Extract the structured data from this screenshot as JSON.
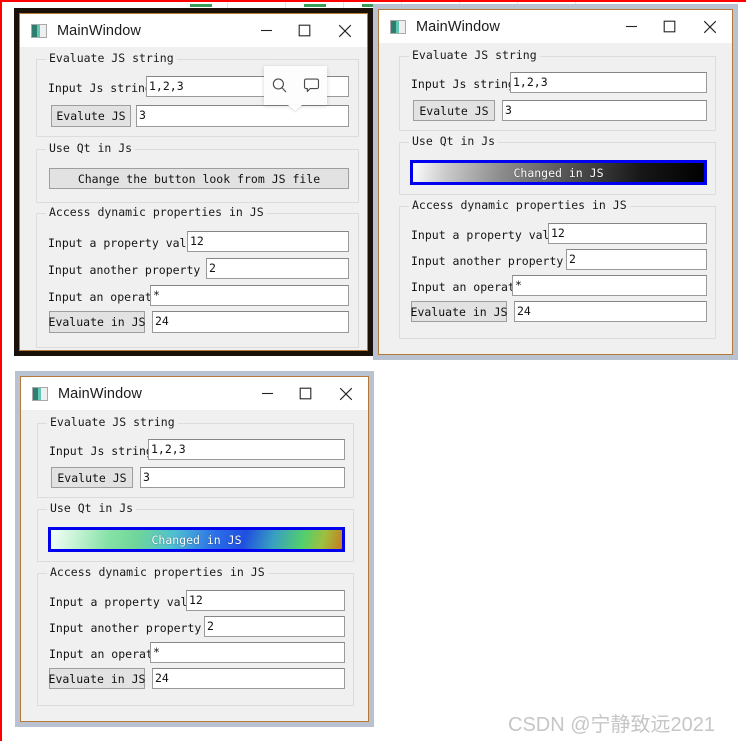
{
  "page": {
    "watermark": "CSDN @宁静致远2021",
    "frame_color": "#fe0000"
  },
  "windows": [
    {
      "id": "window-1",
      "title": "MainWindow",
      "state": "active",
      "border_color": "#1a1208",
      "controls": {
        "minimize": "minimize",
        "maximize": "maximize",
        "close": "close"
      },
      "groups": [
        {
          "title": "Evaluate JS string",
          "rows": [
            {
              "label": "Input Js string",
              "value": "1,2,3"
            },
            {
              "button": "Evalute JS",
              "value": "3"
            }
          ]
        },
        {
          "title": "Use Qt in Js",
          "button": "Change the button look from JS file",
          "button_style": "default"
        },
        {
          "title": "Access dynamic properties in JS",
          "rows": [
            {
              "label": "Input a property value",
              "value": "12"
            },
            {
              "label": "Input another property value",
              "value": "2"
            },
            {
              "label": "Input an operator",
              "value": "*"
            },
            {
              "button": "Evaluate in JS",
              "value": "24"
            }
          ]
        }
      ],
      "popup": {
        "icons": [
          "search-icon",
          "comment-icon"
        ]
      }
    },
    {
      "id": "window-2",
      "title": "MainWindow",
      "state": "inactive",
      "border_color": "#b9c2d0",
      "controls": {
        "minimize": "minimize",
        "maximize": "maximize",
        "close": "close"
      },
      "groups": [
        {
          "title": "Evaluate JS string",
          "rows": [
            {
              "label": "Input Js string",
              "value": "1,2,3"
            },
            {
              "button": "Evalute JS",
              "value": "3"
            }
          ]
        },
        {
          "title": "Use Qt in Js",
          "button": "Changed in JS",
          "button_style": "styled-mono",
          "button_border_color": "#0000ee"
        },
        {
          "title": "Access dynamic properties in JS",
          "rows": [
            {
              "label": "Input a property value",
              "value": "12"
            },
            {
              "label": "Input another property value",
              "value": "2"
            },
            {
              "label": "Input an operator",
              "value": "*"
            },
            {
              "button": "Evaluate in JS",
              "value": "24"
            }
          ]
        }
      ]
    },
    {
      "id": "window-3",
      "title": "MainWindow",
      "state": "inactive",
      "border_color": "#b9c2d0",
      "controls": {
        "minimize": "minimize",
        "maximize": "maximize",
        "close": "close"
      },
      "groups": [
        {
          "title": "Evaluate JS string",
          "rows": [
            {
              "label": "Input Js string",
              "value": "1,2,3"
            },
            {
              "button": "Evalute JS",
              "value": "3"
            }
          ]
        },
        {
          "title": "Use Qt in Js",
          "button": "Changed in JS",
          "button_style": "styled-color",
          "button_border_color": "#0000ee"
        },
        {
          "title": "Access dynamic properties in JS",
          "rows": [
            {
              "label": "Input a property value",
              "value": "12"
            },
            {
              "label": "Input another property value",
              "value": "2"
            },
            {
              "label": "Input an operator",
              "value": "*"
            },
            {
              "button": "Evaluate in JS",
              "value": "24"
            }
          ]
        }
      ]
    }
  ]
}
